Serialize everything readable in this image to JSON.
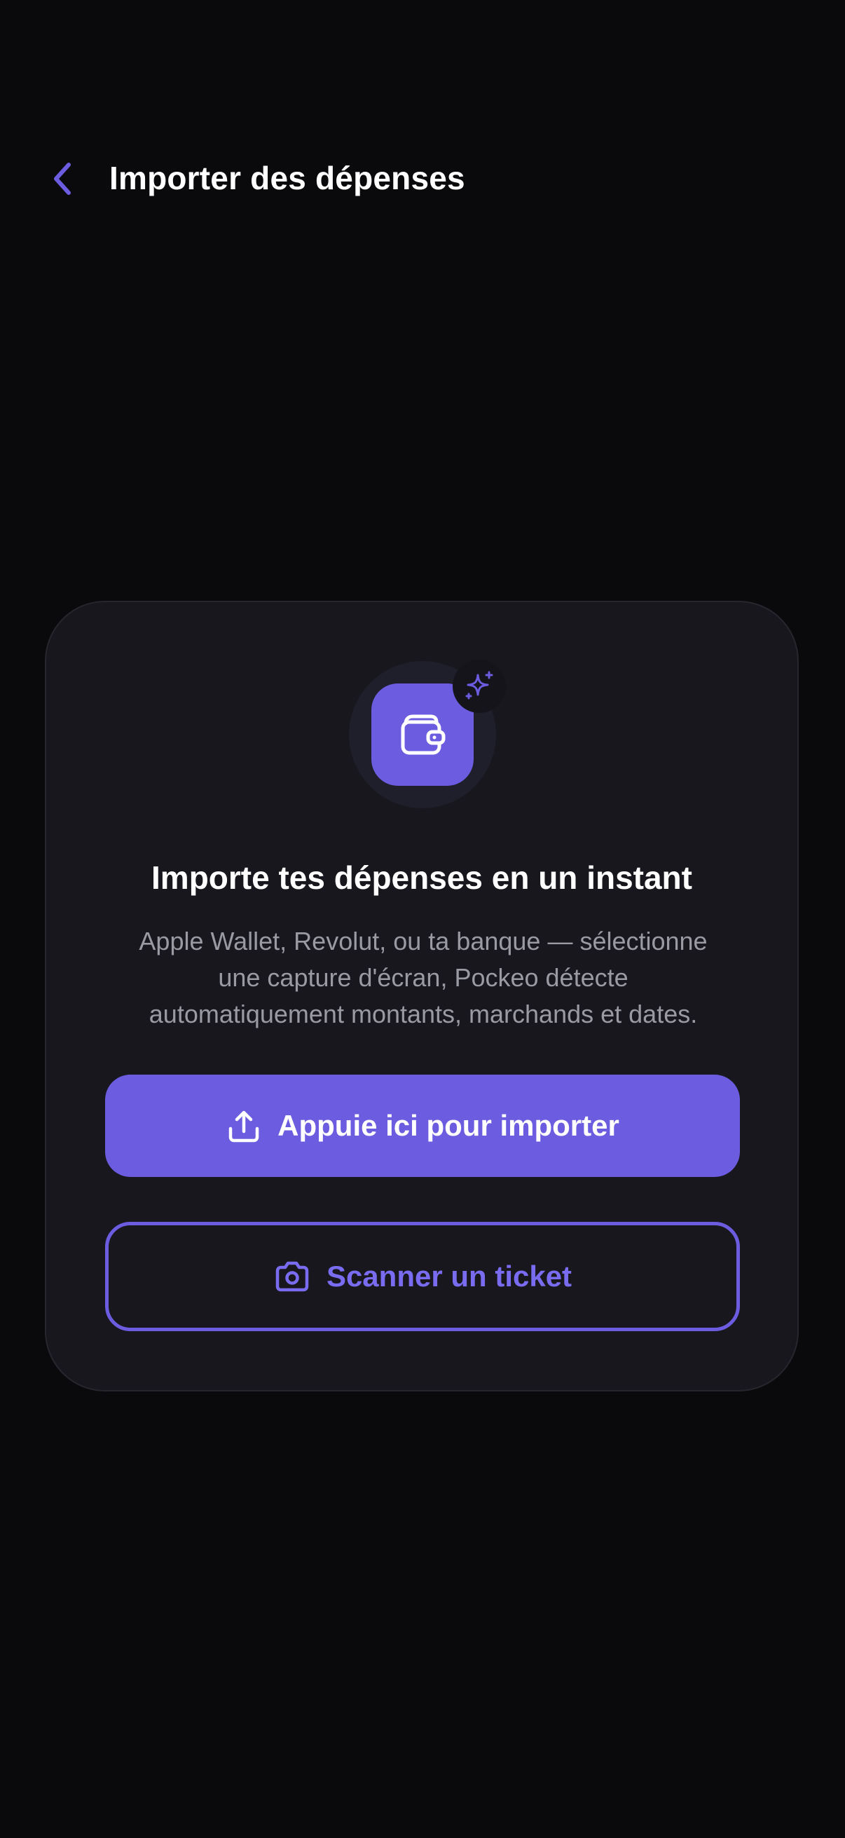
{
  "header": {
    "back_icon": "chevron-left-icon",
    "title": "Importer des dépenses"
  },
  "card": {
    "main_icon": "wallet-icon",
    "badge_icon": "sparkle-icon",
    "title": "Importe tes dépenses en un instant",
    "description": "Apple Wallet, Revolut, ou ta banque — sélectionne\nune capture d'écran, Pockeo détecte\nautomatiquement montants, marchands et dates.",
    "primary_button": {
      "label": "Appuie ici pour importer",
      "icon": "upload-icon"
    },
    "secondary_button": {
      "label": "Scanner un ticket",
      "icon": "camera-icon"
    }
  },
  "colors": {
    "background": "#0a0a0c",
    "card": "#17171d",
    "accent": "#6b5ce0",
    "text_primary": "#ffffff",
    "text_secondary": "#9a9aa3"
  }
}
